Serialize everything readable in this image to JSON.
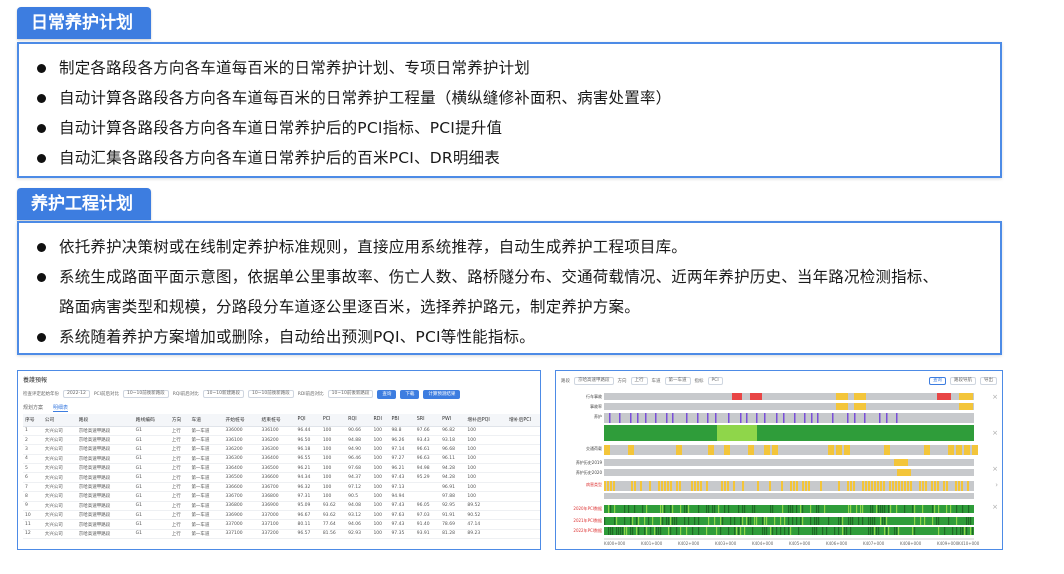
{
  "section1": {
    "title": "日常养护计划",
    "bullets": [
      "制定各路段各方向各车道每百米的日常养护计划、专项日常养护计划",
      "自动计算各路段各方向各车道每百米的日常养护工程量（横纵缝修补面积、病害处置率）",
      "自动计算各路段各方向各车道日常养护后的PCI指标、PCI提升值",
      "自动汇集各路段各方向各车道日常养护后的百米PCI、DR明细表"
    ]
  },
  "section2": {
    "title": "养护工程计划",
    "bullets": [
      {
        "line1": "依托养护决策树或在线制定养护标准规则，直接应用系统推荐，自动生成养护工程项目库。",
        "line2": ""
      },
      {
        "line1": "系统生成路面平面示意图，依据单公里事故率、伤亡人数、路桥隧分布、交通荷载情况、近两年养护历史、当年路况检测指标、",
        "line2": "路面病害类型和规模，分路段分车道逐公里逐百米，选择养护路元，制定养护方案。"
      },
      {
        "line1": "系统随着养护方案增加或删除，自动给出预测PQI、PCI等性能指标。",
        "line2": ""
      }
    ]
  },
  "left_shot": {
    "title": "養護預報",
    "filters": [
      "2022-12",
      "10~10前後新路段",
      "10~10新建路段",
      "10~10前後新路段",
      "10~10前後新路段"
    ],
    "filter_labels": [
      "检查评定起始年份",
      "PCI前后对比",
      "RQI前后对比",
      "RDI前后对比"
    ],
    "buttons": [
      "查询",
      "下载",
      "计算预测结果"
    ],
    "tabs": [
      "规划方案",
      "明细表"
    ],
    "columns": [
      "序号",
      "公司",
      "路段",
      "路线编码",
      "方向",
      "车道",
      "开始桩号",
      "结束桩号",
      "PQI",
      "PCI",
      "RQI",
      "RDI",
      "PBI",
      "SRI",
      "PWI",
      "增补后PQI",
      "增补后PCI"
    ],
    "rows": [
      [
        "1",
        "大兴公司",
        "京哈高速甲路段",
        "G1",
        "上行",
        "第一车道",
        "336000",
        "336100",
        "96.44",
        "100",
        "90.66",
        "100",
        "98.8",
        "97.66",
        "96.82",
        "100"
      ],
      [
        "2",
        "大兴公司",
        "京哈高速甲路段",
        "G1",
        "上行",
        "第一车道",
        "336100",
        "336200",
        "96.50",
        "100",
        "94.88",
        "100",
        "96.26",
        "93.43",
        "93.18",
        "100"
      ],
      [
        "3",
        "大兴公司",
        "京哈高速甲路段",
        "G1",
        "上行",
        "第一车道",
        "336200",
        "336300",
        "96.18",
        "100",
        "94.90",
        "100",
        "97.14",
        "96.61",
        "96.68",
        "100"
      ],
      [
        "4",
        "大兴公司",
        "京哈高速甲路段",
        "G1",
        "上行",
        "第一车道",
        "336300",
        "336400",
        "96.55",
        "100",
        "96.46",
        "100",
        "97.27",
        "96.63",
        "96.11",
        "100"
      ],
      [
        "5",
        "大兴公司",
        "京哈高速甲路段",
        "G1",
        "上行",
        "第一车道",
        "336400",
        "336500",
        "96.21",
        "100",
        "97.68",
        "100",
        "96.21",
        "94.98",
        "94.28",
        "100"
      ],
      [
        "6",
        "大兴公司",
        "京哈高速甲路段",
        "G1",
        "上行",
        "第一车道",
        "336500",
        "336600",
        "94.34",
        "100",
        "94.37",
        "100",
        "97.43",
        "95.29",
        "94.28",
        "100"
      ],
      [
        "7",
        "大兴公司",
        "京哈高速甲路段",
        "G1",
        "上行",
        "第一车道",
        "336600",
        "336700",
        "96.32",
        "100",
        "97.12",
        "100",
        "97.13",
        "",
        "96.91",
        "100"
      ],
      [
        "8",
        "大兴公司",
        "京哈高速甲路段",
        "G1",
        "上行",
        "第一车道",
        "336700",
        "336800",
        "97.31",
        "100",
        "90.5",
        "100",
        "94.94",
        "",
        "97.88",
        "100"
      ],
      [
        "9",
        "大兴公司",
        "京哈高速甲路段",
        "G1",
        "上行",
        "第一车道",
        "336800",
        "336900",
        "95.09",
        "93.62",
        "94.08",
        "100",
        "97.43",
        "96.05",
        "92.95",
        "89.52"
      ],
      [
        "10",
        "大兴公司",
        "京哈高速甲路段",
        "G1",
        "上行",
        "第一车道",
        "336900",
        "337000",
        "96.67",
        "93.62",
        "93.12",
        "100",
        "97.63",
        "97.03",
        "91.91",
        "90.52"
      ],
      [
        "11",
        "大兴公司",
        "京哈高速甲路段",
        "G1",
        "上行",
        "第一车道",
        "337000",
        "337100",
        "80.11",
        "77.64",
        "94.06",
        "100",
        "97.43",
        "91.40",
        "78.69",
        "47.14"
      ],
      [
        "12",
        "大兴公司",
        "京哈高速甲路段",
        "G1",
        "上行",
        "第一车道",
        "337100",
        "337200",
        "96.57",
        "81.56",
        "92.93",
        "100",
        "97.35",
        "93.91",
        "81.28",
        "89.23"
      ]
    ]
  },
  "right_shot": {
    "toolbar_labels": [
      "路段",
      "京哈高速甲路段",
      "方向",
      "上行",
      "车道",
      "第一车道",
      "指标",
      "PCI"
    ],
    "toolbar_buttons": [
      "查询",
      "路段导航",
      "导出"
    ],
    "row_labels": [
      "行车事故",
      "事故率",
      "养护",
      "",
      "交通荷载",
      "养护历史2019",
      "养护历史2020",
      "病害类型",
      "",
      "2020年PCI数据",
      "2021年PCI数据",
      "2022年PCI数据"
    ],
    "x_ticks": [
      "K400+000",
      "K401+000",
      "K402+000",
      "K403+000",
      "K404+000",
      "K405+000",
      "K406+000",
      "K407+000",
      "K408+000",
      "K409+000",
      "K410+000"
    ],
    "colors": {
      "grey": "#c7c9cc",
      "red": "#e84545",
      "yellow": "#f3c53a",
      "purple": "#7a4fd8",
      "green": "#2f9d3a",
      "lightgreen": "#8fd64a"
    }
  }
}
